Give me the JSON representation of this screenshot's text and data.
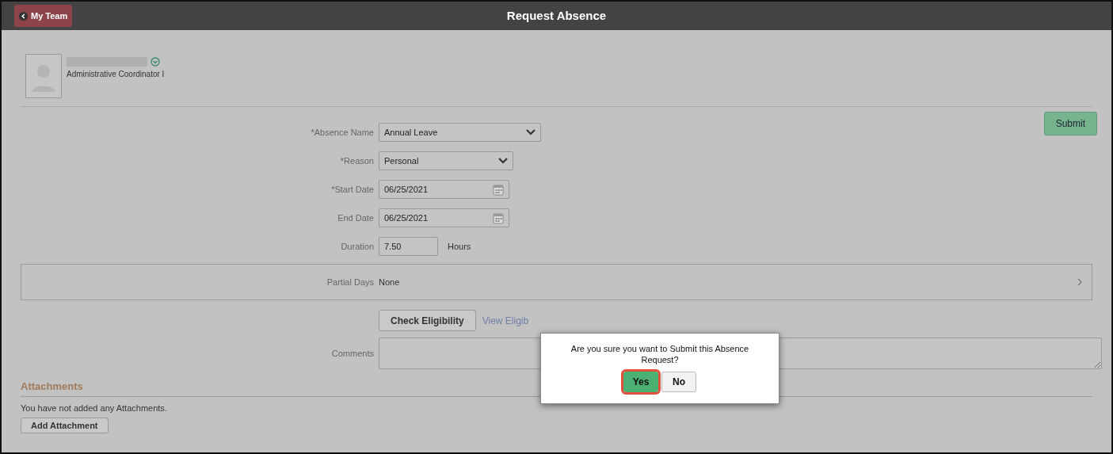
{
  "header": {
    "back_button": "My Team",
    "title": "Request Absence"
  },
  "employee": {
    "job_title": "Administrative Coordinator I"
  },
  "submit_button": "Submit",
  "fields": [
    {
      "kind": "select",
      "label": "*Absence Name",
      "value": "Annual Leave",
      "wide": true
    },
    {
      "kind": "select",
      "label": "*Reason",
      "value": "Personal",
      "wide": false
    },
    {
      "kind": "date",
      "label": "*Start Date",
      "value": "06/25/2021"
    },
    {
      "kind": "date",
      "label": "End Date",
      "value": "06/25/2021"
    },
    {
      "kind": "number",
      "label": "Duration",
      "value": "7.50",
      "unit": "Hours"
    }
  ],
  "partial_days": {
    "label": "Partial Days",
    "value": "None"
  },
  "check_eligibility_button": "Check Eligibility",
  "eligibility_link": "View Eligib",
  "comments": {
    "label": "Comments"
  },
  "attachments": {
    "heading": "Attachments",
    "message": "You have not added any Attachments.",
    "add_button": "Add Attachment"
  },
  "dialog": {
    "message": "Are you sure you want to Submit this Absence Request?",
    "buttons": [
      {
        "label": "Yes",
        "kind": "primary",
        "highlighted": true
      },
      {
        "label": "No",
        "kind": "secondary",
        "highlighted": false
      }
    ]
  }
}
